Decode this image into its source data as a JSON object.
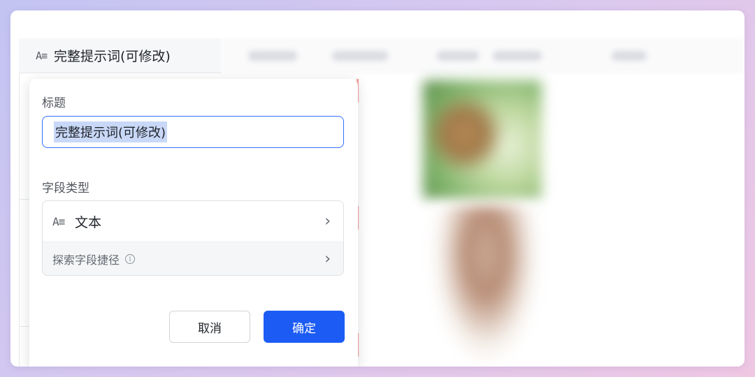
{
  "column_header": {
    "icon": "text-field-icon",
    "icon_glyph": "A≡",
    "label": "完整提示词(可修改)"
  },
  "dialog": {
    "title_label": "标题",
    "title_value": "完整提示词(可修改)",
    "field_type_label": "字段类型",
    "field_type": {
      "icon": "text-field-icon",
      "icon_glyph": "A≡",
      "value": "文本"
    },
    "shortcut": {
      "label": "探索字段捷径",
      "info_icon": "info-icon",
      "info_glyph": "i"
    },
    "chevron_glyph": "›",
    "cancel_label": "取消",
    "confirm_label": "确定"
  },
  "colors": {
    "accent": "#1c5cf5",
    "input_focus_border": "#3370ff",
    "selection": "#c9d8f7"
  }
}
